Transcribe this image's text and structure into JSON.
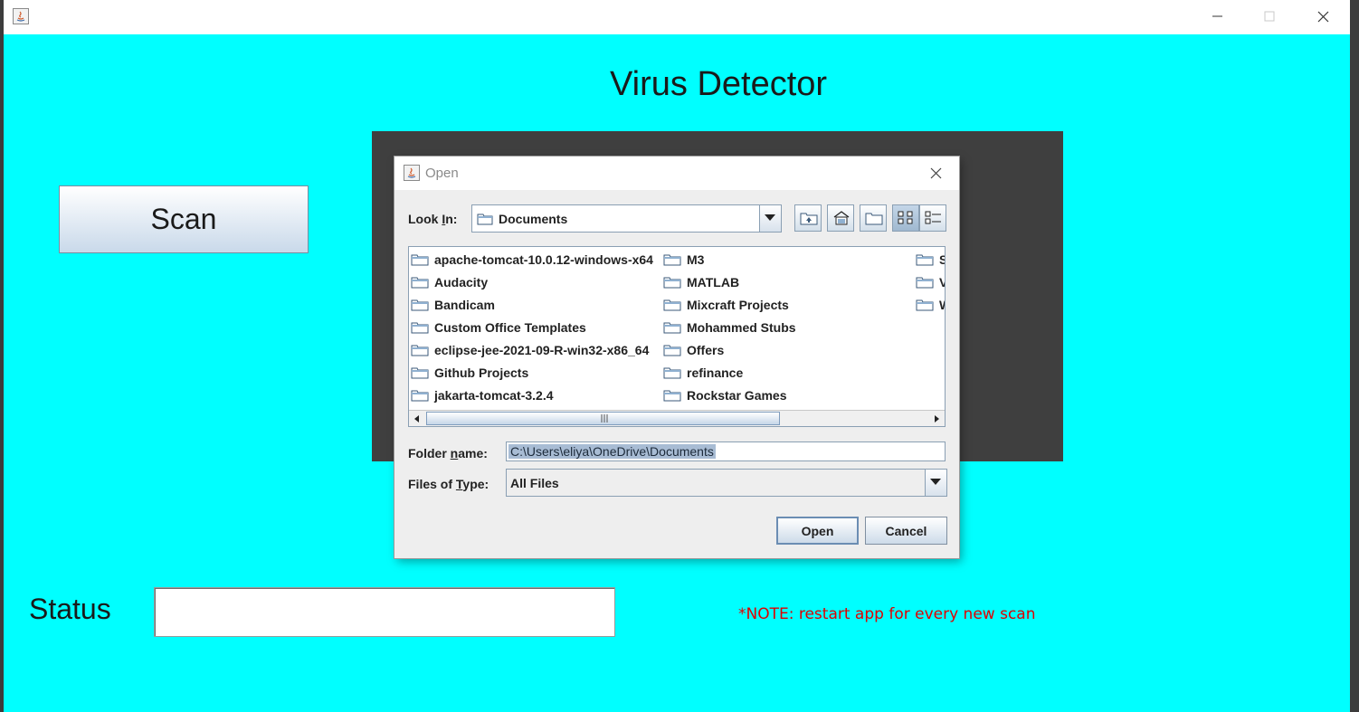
{
  "window": {
    "title": ""
  },
  "app": {
    "title": "Virus Detector",
    "scan_label": "Scan",
    "status_label": "Status",
    "status_value": "",
    "note": "*NOTE: restart app for every new scan"
  },
  "colors": {
    "background": "#00ffff",
    "note": "#e00000",
    "panel": "#3f3f3f"
  },
  "dialog": {
    "title": "Open",
    "look_in_label_pre": "Look ",
    "look_in_label_key": "I",
    "look_in_label_post": "n:",
    "look_in_value": "Documents",
    "toolbar_icons": [
      "up-one-level-icon",
      "home-icon",
      "new-folder-icon",
      "list-view-icon",
      "details-view-icon"
    ],
    "files": [
      "apache-tomcat-10.0.12-windows-x64",
      "Audacity",
      "Bandicam",
      "Custom Office Templates",
      "eclipse-jee-2021-09-R-win32-x86_64",
      "Github Projects",
      "jakarta-tomcat-3.2.4",
      "M3",
      "MATLAB",
      "Mixcraft Projects",
      "Mohammed Stubs",
      "Offers",
      "refinance",
      "Rockstar Games",
      "S",
      "V",
      "W"
    ],
    "folder_name_label_pre": "Folder ",
    "folder_name_label_key": "n",
    "folder_name_label_post": "ame:",
    "folder_name_value": "C:\\Users\\eliya\\OneDrive\\Documents",
    "files_of_type_label_pre": "Files of ",
    "files_of_type_label_key": "T",
    "files_of_type_label_post": "ype:",
    "files_of_type_value": "All Files",
    "open_label": "Open",
    "cancel_label": "Cancel"
  }
}
